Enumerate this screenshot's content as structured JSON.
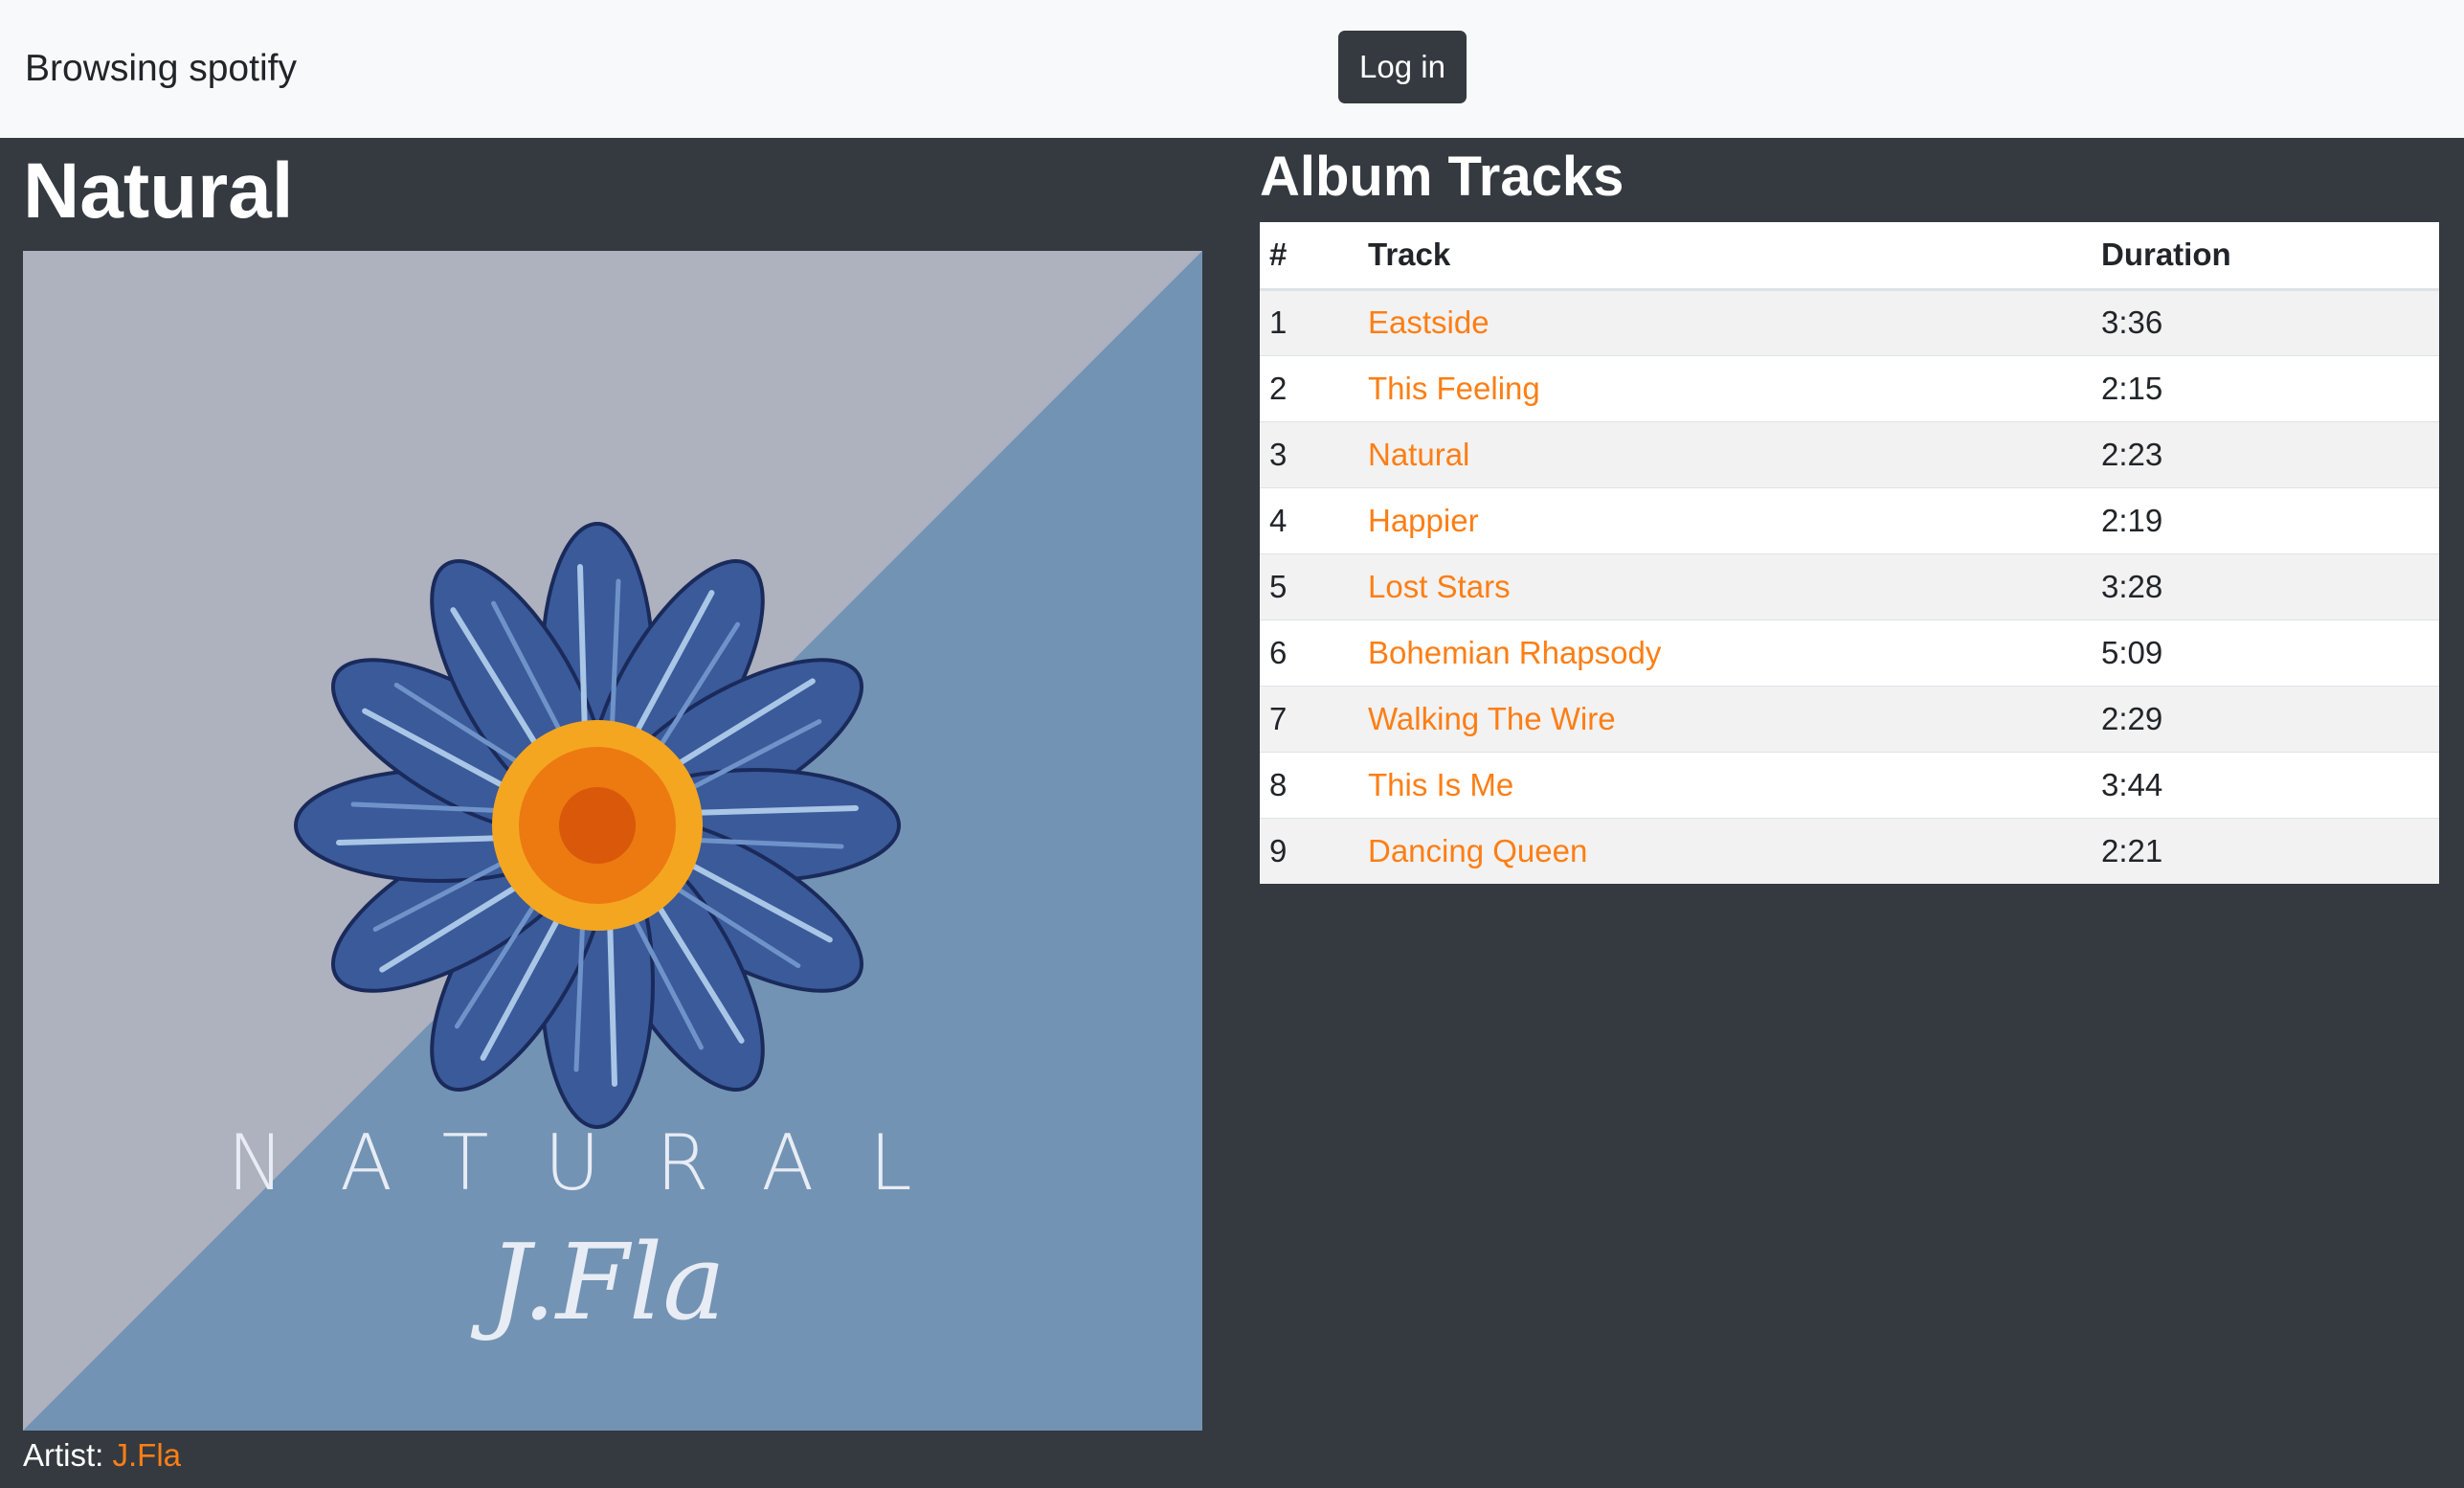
{
  "navbar": {
    "brand": "Browsing spotify",
    "login_label": "Log in"
  },
  "album": {
    "title": "Natural",
    "cover_text": "NATURAL",
    "cover_signature": "J.Fla",
    "artist_label": "Artist: ",
    "artist_name": "J.Fla"
  },
  "tracks": {
    "heading": "Album Tracks",
    "columns": [
      "#",
      "Track",
      "Duration"
    ],
    "rows": [
      {
        "num": "1",
        "name": "Eastside",
        "duration": "3:36"
      },
      {
        "num": "2",
        "name": "This Feeling",
        "duration": "2:15"
      },
      {
        "num": "3",
        "name": "Natural",
        "duration": "2:23"
      },
      {
        "num": "4",
        "name": "Happier",
        "duration": "2:19"
      },
      {
        "num": "5",
        "name": "Lost Stars",
        "duration": "3:28"
      },
      {
        "num": "6",
        "name": "Bohemian Rhapsody",
        "duration": "5:09"
      },
      {
        "num": "7",
        "name": "Walking The Wire",
        "duration": "2:29"
      },
      {
        "num": "8",
        "name": "This Is Me",
        "duration": "3:44"
      },
      {
        "num": "9",
        "name": "Dancing Queen",
        "duration": "2:21"
      }
    ]
  },
  "colors": {
    "accent": "#fd7e14",
    "page_background": "#343a40",
    "navbar_background": "#f8f9fa",
    "cover_gray": "#aeb1be",
    "cover_blue": "#7293b4"
  }
}
